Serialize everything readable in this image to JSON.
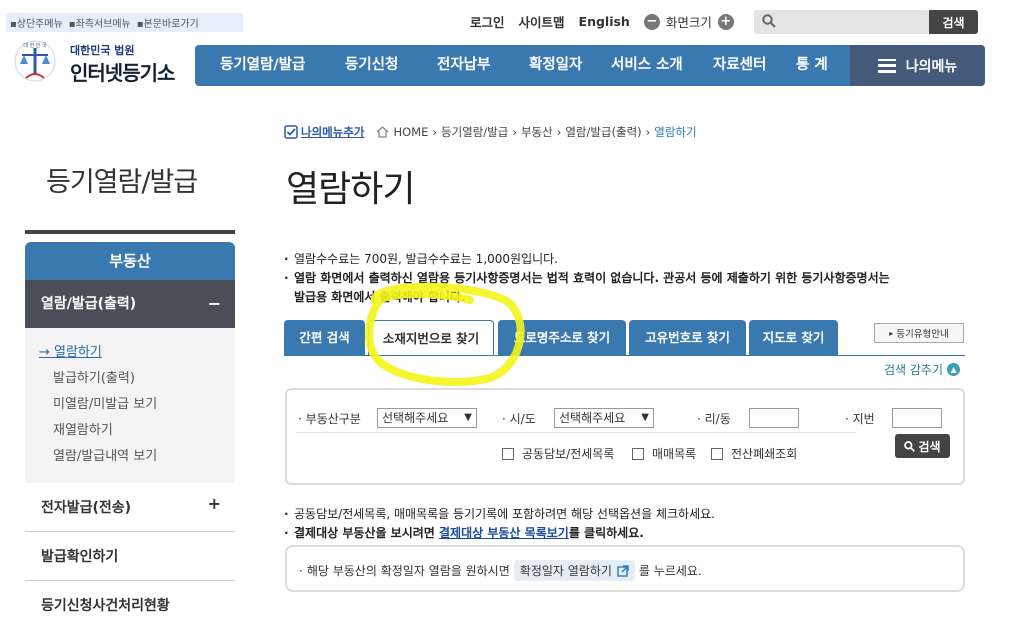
{
  "skip_links": [
    "상단주메뉴",
    "좌측서브메뉴",
    "본문바로가기"
  ],
  "logo": {
    "sub": "대한민국 법원",
    "main": "인터넷등기소"
  },
  "util": {
    "login": "로그인",
    "sitemap": "사이트맵",
    "english": "English",
    "zoom_label": "화면크기"
  },
  "search": {
    "placeholder": "",
    "button": "검색"
  },
  "gnb": [
    "등기열람/발급",
    "등기신청",
    "전자납부",
    "확정일자",
    "서비스 소개",
    "자료센터",
    "통 계"
  ],
  "my_menu": "나의메뉴",
  "breadcrumb": {
    "add": "나의메뉴추가",
    "items": [
      "HOME",
      "등기열람/발급",
      "부동산",
      "열람/발급(출력)",
      "열람하기"
    ]
  },
  "side": {
    "title": "등기열람/발급",
    "head": "부동산",
    "active": "열람/발급(출력)",
    "sub": [
      "열람하기",
      "발급하기(출력)",
      "미열람/미발급 보기",
      "재열람하기",
      "열람/발급내역 보기"
    ],
    "items": [
      "전자발급(전송)",
      "발급확인하기",
      "등기신청사건처리현황"
    ]
  },
  "page_title": "열람하기",
  "notes": {
    "n1": "열람수수료는 700원, 발급수수료는 1,000원입니다.",
    "n2a": "열람 화면에서 출력하신 열람용 등기사항증명서는 법적 효력이 없습니다. 관공서 등에 제출하기 위한 등기사항증명서는",
    "n2b": "발급용 화면에서 출력해야 합니다."
  },
  "tabs": [
    "간편 검색",
    "소재지번으로 찾기",
    "도로명주소로 찾기",
    "고유번호로 찾기",
    "지도로 찾기"
  ],
  "guide_btn": "등기유형안내",
  "toggle_label": "검색 감추기",
  "form": {
    "type_label": "부동산구분",
    "type_value": "선택해주세요",
    "sido_label": "시/도",
    "sido_value": "선택해주세요",
    "ri_label": "리/동",
    "jibun_label": "지번",
    "checkboxes": [
      "공동담보/전세목록",
      "매매목록",
      "전산폐쇄조회"
    ],
    "search_btn": "검색"
  },
  "notes2": {
    "n1": "공동담보/전세목록, 매매목록을 등기기록에 포함하려면 해당 선택옵션을 체크하세요.",
    "n2_pre": "결제대상 부동산을 보시려면 ",
    "n2_link": "결제대상 부동산 목록보기",
    "n2_post": "를 클릭하세요."
  },
  "info": {
    "pre": "해당 부동산의 확정일자 열람을 원하시면",
    "btn": "확정일자 열람하기",
    "post": "를 누르세요."
  },
  "colors": {
    "primary": "#3a78b0",
    "dark": "#4b4d57",
    "highlight": "#f4f41a"
  }
}
